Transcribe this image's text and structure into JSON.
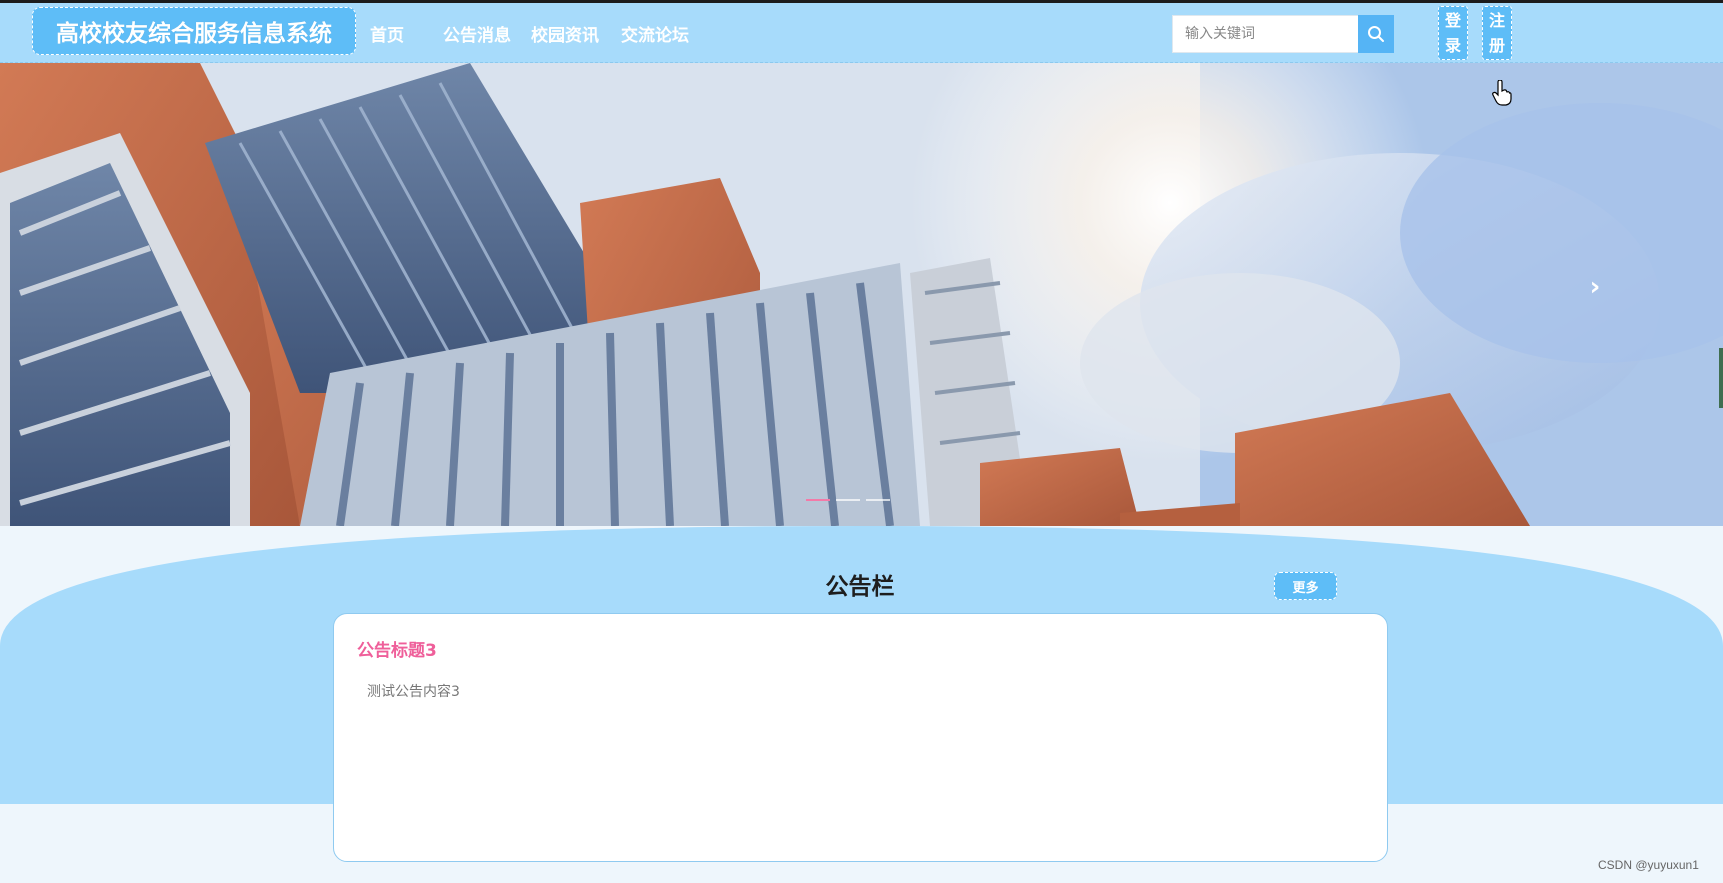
{
  "header": {
    "site_title": "高校校友综合服务信息系统",
    "nav": [
      {
        "label": "首页"
      },
      {
        "label": "公告消息"
      },
      {
        "label": "校园资讯"
      },
      {
        "label": "交流论坛"
      }
    ],
    "search": {
      "placeholder": "输入关键词",
      "icon": "search-icon"
    },
    "login": {
      "line1": "登",
      "line2": "录"
    },
    "register": {
      "line1": "注",
      "line2": "册"
    }
  },
  "banner": {
    "next_icon": "chevron-right-icon",
    "slide_count": 3,
    "active_slide": 1
  },
  "notice": {
    "section_title": "公告栏",
    "more_label": "更多",
    "item": {
      "title": "公告标题3",
      "content": "测试公告内容3"
    }
  },
  "watermark": "CSDN @yuyuxun1",
  "colors": {
    "header_bg": "#a7dbfb",
    "accent": "#5ebdf7",
    "title_pink": "#ef5f9a"
  }
}
